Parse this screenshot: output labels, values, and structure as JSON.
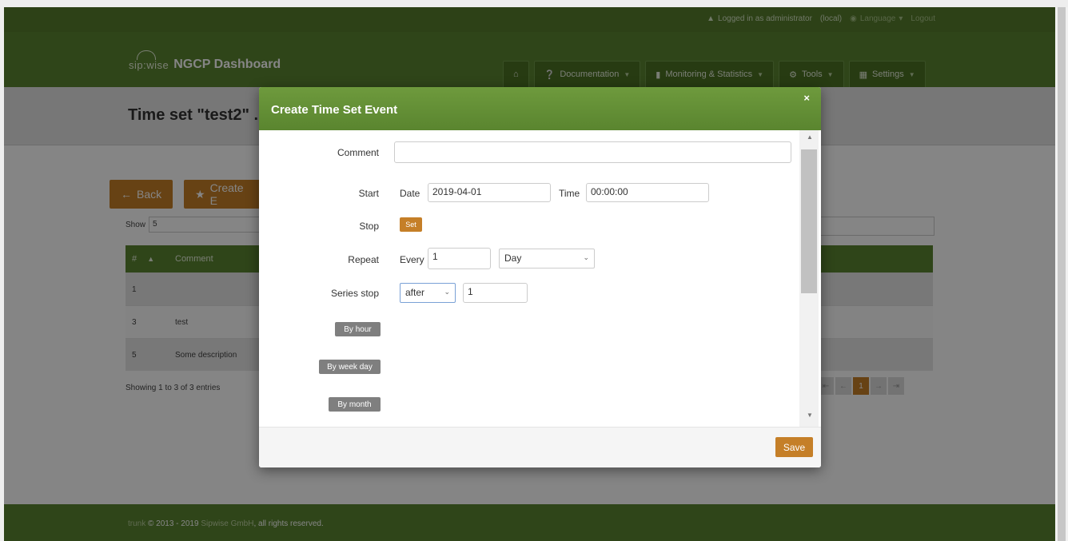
{
  "topbar": {
    "logged_in": "Logged in as administrator",
    "realm": "(local)",
    "language": "Language",
    "logout": "Logout"
  },
  "header": {
    "logo_text": "sip:wise",
    "title": "NGCP Dashboard",
    "nav": [
      {
        "label": "Documentation"
      },
      {
        "label": "Monitoring & Statistics"
      },
      {
        "label": "Tools"
      },
      {
        "label": "Settings"
      }
    ]
  },
  "page": {
    "title": "Time set \"test2\" ."
  },
  "actions": {
    "back": "Back",
    "create": "Create E"
  },
  "listing": {
    "show_label": "Show",
    "show_value": "5",
    "columns": [
      "#",
      "Comment"
    ],
    "rows": [
      {
        "id": "1",
        "comment": ""
      },
      {
        "id": "3",
        "comment": "test"
      },
      {
        "id": "5",
        "comment": "Some description"
      }
    ],
    "showing": "Showing 1 to 3 of 3 entries",
    "pager": [
      "⇤",
      "←",
      "1",
      "→",
      "⇥"
    ]
  },
  "footer": {
    "prefix": "trunk",
    "copyright": "© 2013 - 2019",
    "company": "Sipwise GmbH",
    "rights": ", all rights reserved."
  },
  "modal": {
    "title": "Create Time Set Event",
    "close": "×",
    "fields": {
      "comment_label": "Comment",
      "comment_value": "",
      "start_label": "Start",
      "date_label": "Date",
      "date_value": "2019-04-01",
      "time_label": "Time",
      "time_value": "00:00:00",
      "stop_label": "Stop",
      "stop_button": "Set",
      "repeat_label": "Repeat",
      "every_label": "Every",
      "every_value": "1",
      "freq_value": "Day",
      "series_stop_label": "Series stop",
      "series_stop_mode": "after",
      "series_stop_count": "1",
      "by_hour": "By hour",
      "by_week_day": "By week day",
      "by_month": "By month"
    },
    "save": "Save"
  }
}
